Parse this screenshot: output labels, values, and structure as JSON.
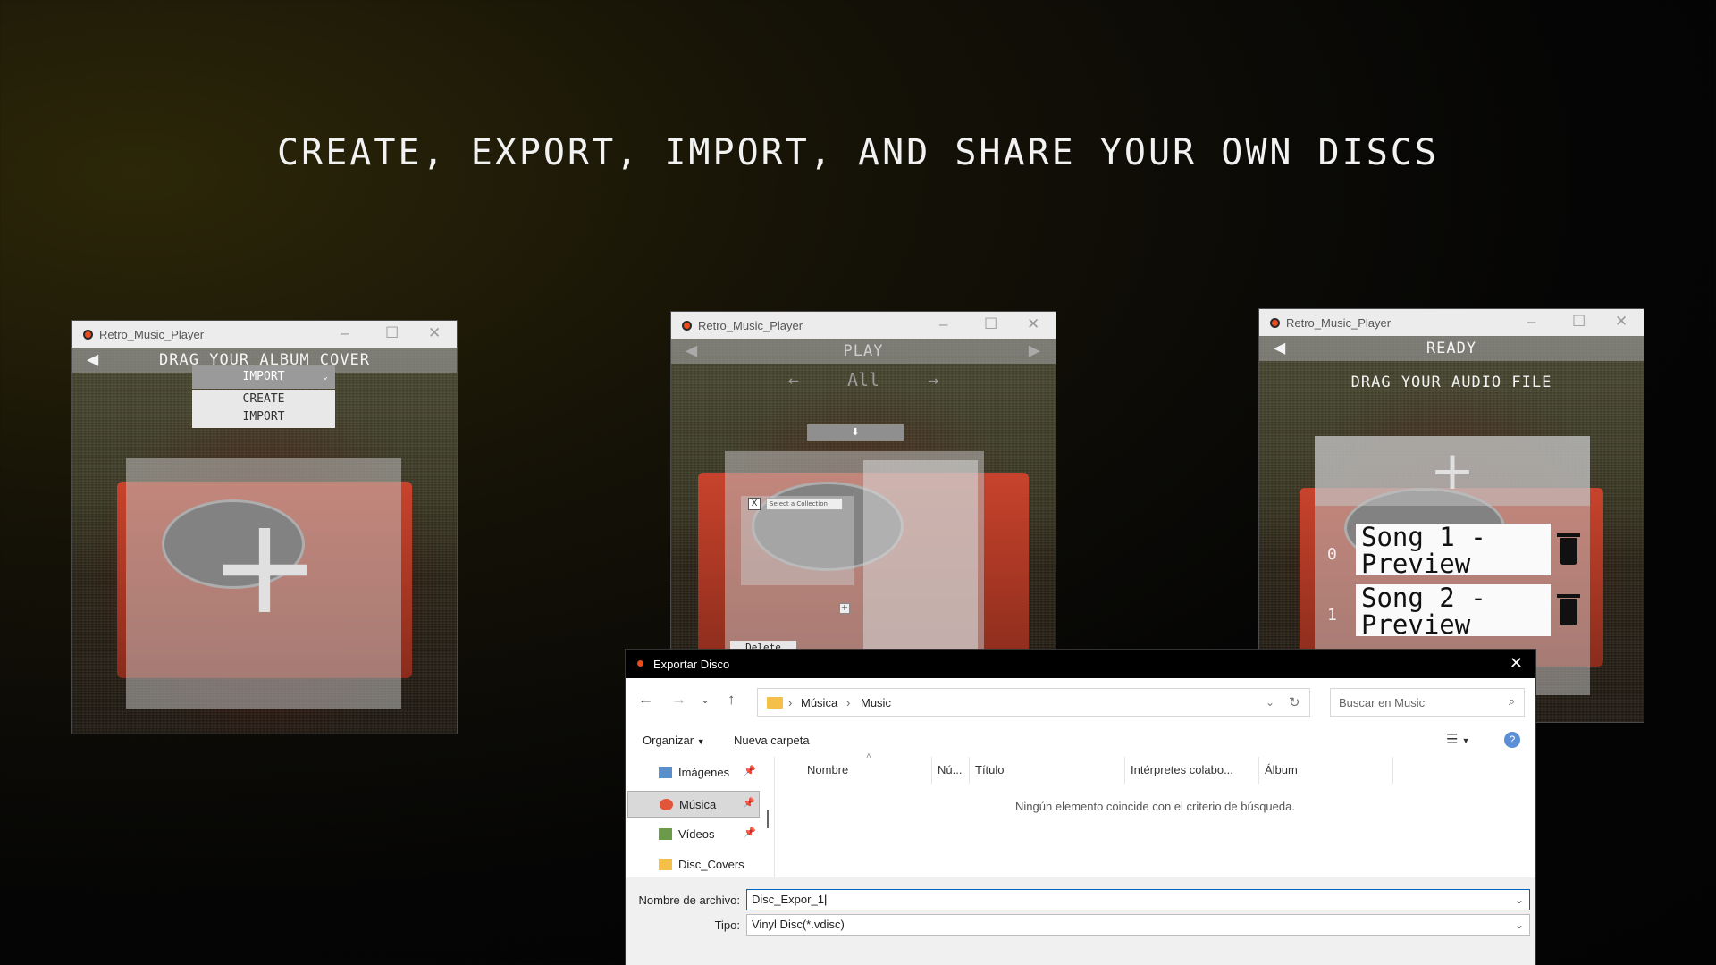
{
  "headline": "CREATE, EXPORT, IMPORT, AND SHARE YOUR OWN DISCS",
  "colors": {
    "accent": "#e94b1c",
    "turntable": "#c8432c",
    "focus": "#0067c0"
  },
  "window1": {
    "title": "Retro_Music_Player",
    "header": "DRAG YOUR ALBUM COVER",
    "dropdown_value": "IMPORT",
    "dropdown_options": [
      "CREATE",
      "IMPORT"
    ]
  },
  "window2": {
    "title": "Retro_Music_Player",
    "header": "PLAY",
    "filter": "All",
    "collection_select": "Select a Collection",
    "delete_label": "Delete"
  },
  "window3": {
    "title": "Retro_Music_Player",
    "header": "READY",
    "subheader": "DRAG YOUR AUDIO FILE",
    "songs": [
      {
        "index": "0",
        "title": "Song 1 - Preview"
      },
      {
        "index": "1",
        "title": "Song 2 - Preview"
      }
    ]
  },
  "dialog": {
    "title": "Exportar Disco",
    "breadcrumb": [
      "Música",
      "Music"
    ],
    "search_placeholder": "Buscar en Music",
    "organize_label": "Organizar",
    "new_folder_label": "Nueva carpeta",
    "sidebar": [
      {
        "label": "Imágenes",
        "icon": "pictures-icon",
        "active": false
      },
      {
        "label": "Música",
        "icon": "music-icon",
        "active": true
      },
      {
        "label": "Vídeos",
        "icon": "videos-icon",
        "active": false
      },
      {
        "label": "Disc_Covers",
        "icon": "folder-icon",
        "active": false
      }
    ],
    "columns": [
      "Nombre",
      "Nú...",
      "Título",
      "Intérpretes colabo...",
      "Álbum"
    ],
    "empty_message": "Ningún elemento coincide con el criterio de búsqueda.",
    "filename_label": "Nombre de archivo:",
    "filename_value": "Disc_Expor_1",
    "type_label": "Tipo:",
    "type_value": "Vinyl Disc(*.vdisc)"
  }
}
